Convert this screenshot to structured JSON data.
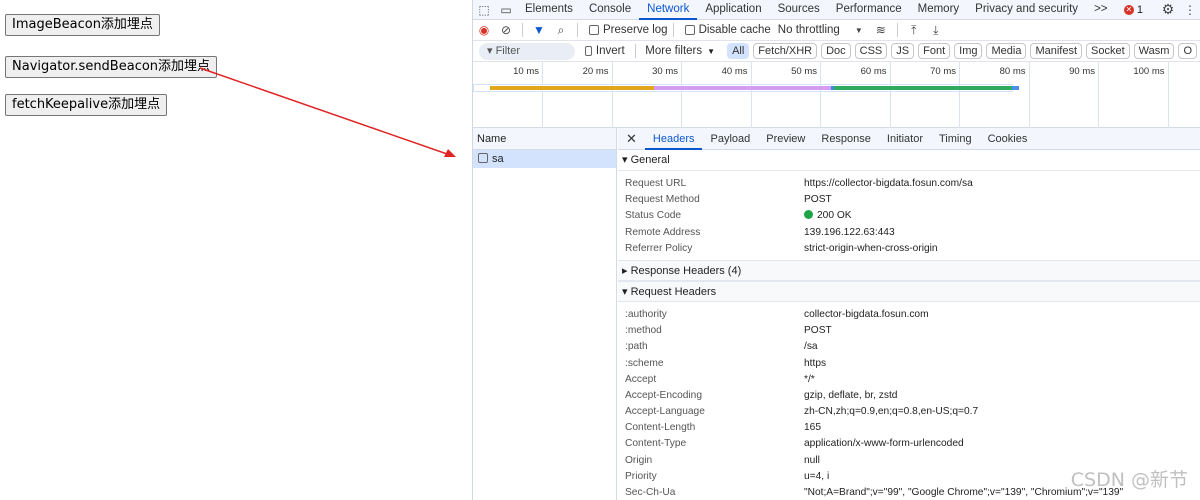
{
  "page": {
    "buttons": [
      "ImageBeacon添加埋点",
      "Navigator.sendBeacon添加埋点",
      "fetchKeepalive添加埋点"
    ]
  },
  "devtools": {
    "tabs": [
      "Elements",
      "Console",
      "Network",
      "Application",
      "Sources",
      "Performance",
      "Memory",
      "Privacy and security"
    ],
    "active_tab": "Network",
    "more": ">>",
    "error_count": "1",
    "toolbar": {
      "preserve_log": "Preserve log",
      "disable_cache": "Disable cache",
      "throttling": "No throttling"
    },
    "filter": {
      "placeholder": "Filter",
      "invert": "Invert",
      "more_filters": "More filters",
      "types": [
        "All",
        "Fetch/XHR",
        "Doc",
        "CSS",
        "JS",
        "Font",
        "Img",
        "Media",
        "Manifest",
        "Socket",
        "Wasm",
        "O"
      ]
    },
    "timeline": {
      "ticks": [
        "10 ms",
        "20 ms",
        "30 ms",
        "40 ms",
        "50 ms",
        "60 ms",
        "70 ms",
        "80 ms",
        "90 ms",
        "100 ms"
      ],
      "segments": [
        {
          "from_ms": 2.5,
          "to_ms": 26,
          "color": "#e2a81d"
        },
        {
          "from_ms": 26,
          "to_ms": 51.5,
          "color": "#d49cf2"
        },
        {
          "from_ms": 51.5,
          "to_ms": 52,
          "color": "#3b8de0"
        },
        {
          "from_ms": 52,
          "to_ms": 77.5,
          "color": "#2eab5c"
        },
        {
          "from_ms": 77.5,
          "to_ms": 78.5,
          "color": "#4d8ff0"
        }
      ]
    },
    "name_header": "Name",
    "requests": [
      "sa"
    ],
    "detail_tabs": [
      "Headers",
      "Payload",
      "Preview",
      "Response",
      "Initiator",
      "Timing",
      "Cookies"
    ],
    "general_title": "General",
    "general": [
      [
        "Request URL",
        "https://collector-bigdata.fosun.com/sa"
      ],
      [
        "Request Method",
        "POST"
      ],
      [
        "Status Code",
        "200 OK"
      ],
      [
        "Remote Address",
        "139.196.122.63:443"
      ],
      [
        "Referrer Policy",
        "strict-origin-when-cross-origin"
      ]
    ],
    "response_headers_title": "Response Headers (4)",
    "request_headers_title": "Request Headers",
    "request_headers": [
      [
        ":authority",
        "collector-bigdata.fosun.com"
      ],
      [
        ":method",
        "POST"
      ],
      [
        ":path",
        "/sa"
      ],
      [
        ":scheme",
        "https"
      ],
      [
        "Accept",
        "*/*"
      ],
      [
        "Accept-Encoding",
        "gzip, deflate, br, zstd"
      ],
      [
        "Accept-Language",
        "zh-CN,zh;q=0.9,en;q=0.8,en-US;q=0.7"
      ],
      [
        "Content-Length",
        "165"
      ],
      [
        "Content-Type",
        "application/x-www-form-urlencoded"
      ],
      [
        "Origin",
        "null"
      ],
      [
        "Priority",
        "u=4, i"
      ],
      [
        "Sec-Ch-Ua",
        "\"Not;A=Brand\";v=\"99\", \"Google Chrome\";v=\"139\", \"Chromium\";v=\"139\""
      ]
    ]
  },
  "watermark": "CSDN @新节",
  "colors": {
    "accent": "#0b57d0",
    "arrow": "#e02424",
    "status_ok": "#1ea446"
  }
}
